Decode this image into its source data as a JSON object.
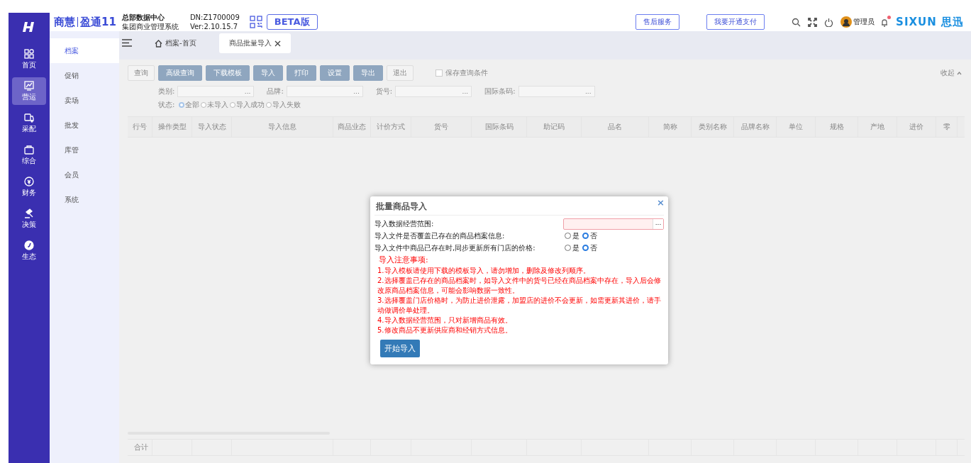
{
  "brand": {
    "product": "商慧",
    "edition": "盈通11",
    "org": "总部数据中心",
    "system": "集团商业管理系统",
    "dn": "DN:Z1700009",
    "version": "Ver:2.10.15.7",
    "beta": "BETA版",
    "vendor": "SIXUN",
    "vendor_cn": "思迅"
  },
  "header_buttons": [
    "售后服务",
    "我要开通支付"
  ],
  "user": {
    "name": "管理员",
    "has_notification": true
  },
  "rail": [
    {
      "label": "首页",
      "selected": false
    },
    {
      "label": "营运",
      "selected": true
    },
    {
      "label": "采配",
      "selected": false
    },
    {
      "label": "综合",
      "selected": false
    },
    {
      "label": "财务",
      "selected": false
    },
    {
      "label": "决策",
      "selected": false
    },
    {
      "label": "生态",
      "selected": false
    }
  ],
  "subnav": [
    {
      "label": "档案",
      "selected": true
    },
    {
      "label": "促销",
      "selected": false
    },
    {
      "label": "卖场",
      "selected": false
    },
    {
      "label": "批发",
      "selected": false
    },
    {
      "label": "库管",
      "selected": false
    },
    {
      "label": "会员",
      "selected": false
    },
    {
      "label": "系统",
      "selected": false
    }
  ],
  "tabs": [
    {
      "label": "档案-首页",
      "kind": "home",
      "selected": false
    },
    {
      "label": "商品批量导入",
      "kind": "closable",
      "selected": true
    }
  ],
  "toolbar": {
    "buttons": [
      {
        "label": "查询",
        "kind": "plain"
      },
      {
        "label": "高级查询",
        "kind": "primary"
      },
      {
        "label": "下载模板",
        "kind": "primary"
      },
      {
        "label": "导入",
        "kind": "primary"
      },
      {
        "label": "打印",
        "kind": "primary"
      },
      {
        "label": "设置",
        "kind": "primary"
      },
      {
        "label": "导出",
        "kind": "primary"
      },
      {
        "label": "退出",
        "kind": "plain"
      }
    ],
    "save_conditions": {
      "label": "保存查询条件",
      "checked": false
    },
    "collapse": "收起"
  },
  "filters": [
    {
      "label": "类别:",
      "button": "..."
    },
    {
      "label": "品牌:",
      "button": "..."
    },
    {
      "label": "货号:",
      "button": "..."
    },
    {
      "label": "国际条码:",
      "button": "..."
    }
  ],
  "status_filter": {
    "label": "状态:",
    "options": [
      {
        "label": "全部",
        "selected": true
      },
      {
        "label": "未导入",
        "selected": false
      },
      {
        "label": "导入成功",
        "selected": false
      },
      {
        "label": "导入失败",
        "selected": false
      }
    ]
  },
  "table": {
    "columns": [
      "行号",
      "操作类型",
      "导入状态",
      "导入信息",
      "商品业态",
      "计价方式",
      "货号",
      "国际条码",
      "助记码",
      "品名",
      "简称",
      "类别名称",
      "品牌名称",
      "单位",
      "规格",
      "产地",
      "进价",
      "零"
    ],
    "footer": "合计"
  },
  "dialog": {
    "title": "批量商品导入",
    "close": "×",
    "fields": [
      {
        "kind": "picker",
        "label": "导入数据经营范围:",
        "button": "...",
        "invalid": true
      },
      {
        "kind": "radio",
        "label": "导入文件是否覆盖已存在的商品档案信息:",
        "options": [
          {
            "label": "是",
            "selected": false
          },
          {
            "label": "否",
            "selected": true
          }
        ]
      },
      {
        "kind": "radio",
        "label": "导入文件中商品已存在时,同步更新所有门店的价格:",
        "options": [
          {
            "label": "是",
            "selected": false
          },
          {
            "label": "否",
            "selected": true
          }
        ]
      }
    ],
    "notes_title": "导入注意事项:",
    "notes": [
      "1.导入模板请使用下载的模板导入，请勿增加，删除及修改列顺序。",
      "2.选择覆盖已存在的商品档案时，如导入文件中的货号已经在商品档案中存在，导入后会修改原商品档案信息，可能会影响数据一致性。",
      "3.选择覆盖门店价格时，为防止进价泄露，加盟店的进价不会更新，如需更新其进价，请手动做调价单处理。",
      "4.导入数据经营范围，只对新增商品有效。",
      "5.修改商品不更新供应商和经销方式信息。"
    ],
    "submit": "开始导入"
  }
}
